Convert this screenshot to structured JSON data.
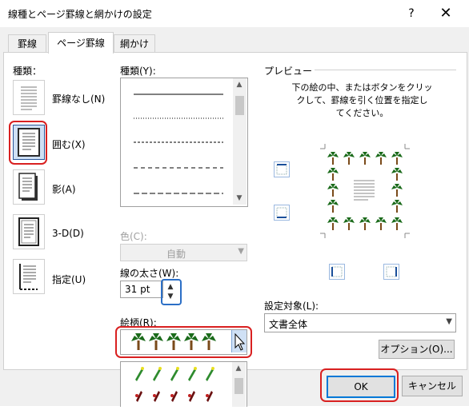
{
  "dialog": {
    "title": "線種とページ罫線と網かけの設定",
    "help": "?",
    "close": "✕"
  },
  "tabs": [
    {
      "label": "罫線"
    },
    {
      "label": "ページ罫線"
    },
    {
      "label": "網かけ"
    }
  ],
  "settings": {
    "header": "種類：",
    "items": [
      {
        "label": "罫線なし(N)"
      },
      {
        "label": "囲む(X)"
      },
      {
        "label": "影(A)"
      },
      {
        "label": "3-D(D)"
      },
      {
        "label": "指定(U)"
      }
    ],
    "selected": "囲む(X)"
  },
  "style": {
    "header": "種類(Y):"
  },
  "color": {
    "label": "色(C):",
    "value": "自動"
  },
  "width": {
    "label": "線の太さ(W):",
    "value": "31 pt"
  },
  "art": {
    "label": "絵柄(R):"
  },
  "preview": {
    "header": "プレビュー",
    "instruction_1": "下の絵の中、またはボタンをクリッ",
    "instruction_2": "クして、罫線を引く位置を指定し",
    "instruction_3": "てください。"
  },
  "apply_to": {
    "label": "設定対象(L):",
    "value": "文書全体"
  },
  "buttons": {
    "options": "オプション(O)...",
    "ok": "OK",
    "cancel": "キャンセル"
  },
  "colors": {
    "highlight_red": "#d92020",
    "focus_blue": "#2b6fc6",
    "default_button_border": "#0078d7"
  }
}
